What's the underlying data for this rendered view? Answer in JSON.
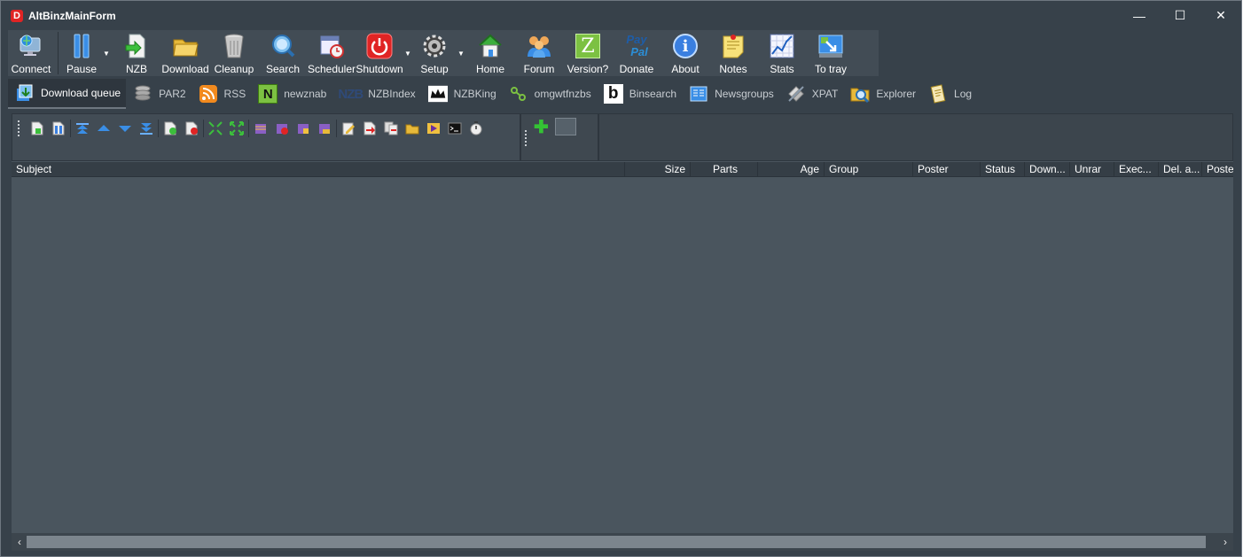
{
  "window": {
    "title": "AltBinzMainForm",
    "logo_letter": "D",
    "minimize": "—",
    "maximize": "☐",
    "close": "✕"
  },
  "toolbar": {
    "buttons": [
      {
        "label": "Connect",
        "icon": "monitor-globe-icon"
      },
      {
        "label": "Pause",
        "icon": "pause-icon"
      },
      {
        "label": "NZB",
        "icon": "nzb-file-icon"
      },
      {
        "label": "Download",
        "icon": "folder-icon"
      },
      {
        "label": "Cleanup",
        "icon": "trash-can-icon"
      },
      {
        "label": "Search",
        "icon": "magnifier-icon"
      },
      {
        "label": "Scheduler",
        "icon": "calendar-clock-icon"
      },
      {
        "label": "Shutdown",
        "icon": "power-icon"
      },
      {
        "label": "Setup",
        "icon": "gear-icon"
      },
      {
        "label": "Home",
        "icon": "house-icon"
      },
      {
        "label": "Forum",
        "icon": "people-icon"
      },
      {
        "label": "Version?",
        "icon": "z-icon"
      },
      {
        "label": "Donate",
        "icon": "paypal-icon"
      },
      {
        "label": "About",
        "icon": "info-icon"
      },
      {
        "label": "Notes",
        "icon": "note-icon"
      },
      {
        "label": "Stats",
        "icon": "chart-icon"
      },
      {
        "label": "To tray",
        "icon": "tray-icon"
      }
    ],
    "paypal_line1": "Pay",
    "paypal_line2": "Pal",
    "version_letter": "Z",
    "info_letter": "i"
  },
  "tabs": [
    {
      "label": "Download queue",
      "icon": "download-queue-icon",
      "active": true
    },
    {
      "label": "PAR2",
      "icon": "par2-stack-icon"
    },
    {
      "label": "RSS",
      "icon": "rss-icon"
    },
    {
      "label": "newznab",
      "icon": "newznab-icon"
    },
    {
      "label": "NZBIndex",
      "icon": "nzbindex-icon"
    },
    {
      "label": "NZBKing",
      "icon": "crown-icon"
    },
    {
      "label": "omgwtfnzbs",
      "icon": "omg-icon"
    },
    {
      "label": "Binsearch",
      "icon": "binsearch-icon"
    },
    {
      "label": "Newsgroups",
      "icon": "newsgroups-icon"
    },
    {
      "label": "XPAT",
      "icon": "xpat-icon"
    },
    {
      "label": "Explorer",
      "icon": "explorer-icon"
    },
    {
      "label": "Log",
      "icon": "log-icon"
    }
  ],
  "tab_glyphs": {
    "newznab": "N",
    "nzbindex": "NZB",
    "binsearch": "b"
  },
  "columns": [
    "Subject",
    "Size",
    "Parts",
    "Age",
    "Group",
    "Poster",
    "Status",
    "Down...",
    "Unrar",
    "Exec...",
    "Del. a...",
    "Poste..."
  ],
  "scroll": {
    "left": "‹",
    "right": "›"
  },
  "colors": {
    "window_bg": "#37414a",
    "grid_bg": "#4a555e",
    "accent_red": "#e02424",
    "accent_blue": "#3a8ee6",
    "accent_green": "#34c234"
  }
}
